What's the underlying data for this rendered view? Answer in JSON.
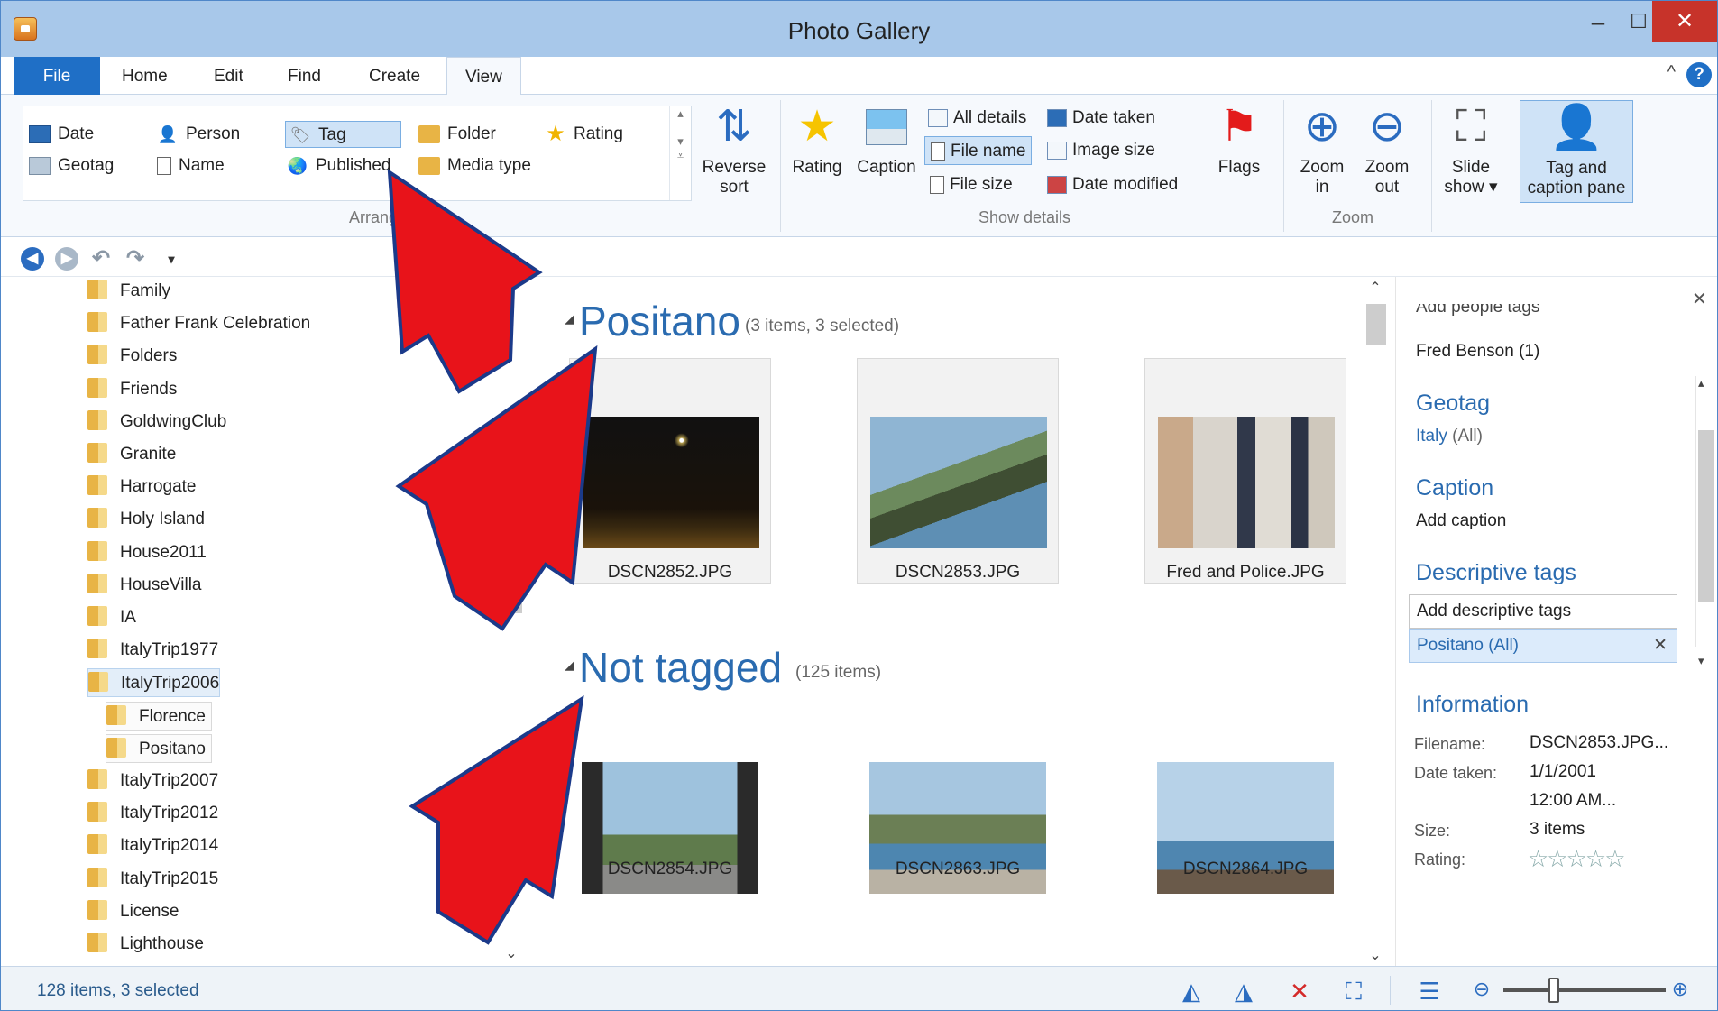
{
  "window": {
    "title": "Photo Gallery",
    "minimize": "–",
    "maximize": "☐",
    "close": "✕"
  },
  "menu": {
    "tabs": [
      "File",
      "Home",
      "Edit",
      "Find",
      "Create",
      "View"
    ],
    "collapse": "^",
    "help": "?"
  },
  "ribbon": {
    "arrange": {
      "label": "Arrange",
      "items": [
        "Date",
        "Person",
        "Tag",
        "Folder",
        "Rating",
        "Geotag",
        "Name",
        "Published",
        "Media type"
      ],
      "icons": [
        "calendar-icon",
        "person-icon",
        "tag-icon",
        "folder-icon",
        "star-icon",
        "map-icon",
        "document-icon",
        "globe-icon",
        "media-icon"
      ]
    },
    "reverse_sort": [
      "Reverse",
      "sort"
    ],
    "show_details": {
      "label": "Show details",
      "rating": "Rating",
      "caption": "Caption",
      "all_details": "All details",
      "file_name": "File name",
      "file_size": "File size",
      "date_taken": "Date taken",
      "image_size": "Image size",
      "date_modified": "Date modified",
      "flags": "Flags"
    },
    "zoom": {
      "label": "Zoom",
      "zoom_in": [
        "Zoom",
        "in"
      ],
      "zoom_out": [
        "Zoom",
        "out"
      ]
    },
    "slideshow": [
      "Slide",
      "show ▾"
    ],
    "tag_caption_pane": [
      "Tag and",
      "caption pane"
    ]
  },
  "qat": {
    "dropdown": "▾"
  },
  "tree": {
    "items": [
      "Family",
      "Father Frank Celebration",
      "Folders",
      "Friends",
      "GoldwingClub",
      "Granite",
      "Harrogate",
      "Holy Island",
      "House2011",
      "HouseVilla",
      "IA",
      "ItalyTrip1977",
      "ItalyTrip2006",
      "Florence",
      "Positano",
      "ItalyTrip2007",
      "ItalyTrip2012",
      "ItalyTrip2014",
      "ItalyTrip2015",
      "License",
      "Lighthouse"
    ]
  },
  "groups": [
    {
      "title": "Positano",
      "subtitle": "(3 items, 3 selected)",
      "photos": [
        "DSCN2852.JPG",
        "DSCN2853.JPG",
        "Fred and Police.JPG"
      ]
    },
    {
      "title": "Not tagged",
      "subtitle": "(125 items)",
      "photos": [
        "DSCN2854.JPG",
        "DSCN2863.JPG",
        "DSCN2864.JPG"
      ]
    }
  ],
  "pane": {
    "people_header": "Add people tags",
    "people": "Fred Benson (1)",
    "geotag_header": "Geotag",
    "geotag_place": "Italy",
    "geotag_all": "(All)",
    "caption_header": "Caption",
    "caption_value": "Add caption",
    "desc_header": "Descriptive tags",
    "desc_placeholder": "Add descriptive tags",
    "desc_tag": "Positano (All)",
    "info_header": "Information",
    "info": [
      {
        "label": "Filename:",
        "value": "DSCN2853.JPG..."
      },
      {
        "label": "Date taken:",
        "value": "1/1/2001"
      },
      {
        "label": "",
        "value": "12:00 AM..."
      },
      {
        "label": "Size:",
        "value": "3 items"
      },
      {
        "label": "Rating:",
        "value": ""
      }
    ],
    "rating_stars": "☆☆☆☆☆",
    "close": "✕"
  },
  "status": {
    "text": "128 items, 3 selected"
  },
  "colors": {
    "accent": "#2a6bb0",
    "file_tab": "#1f6fc6",
    "arrow": "#e8131a"
  }
}
